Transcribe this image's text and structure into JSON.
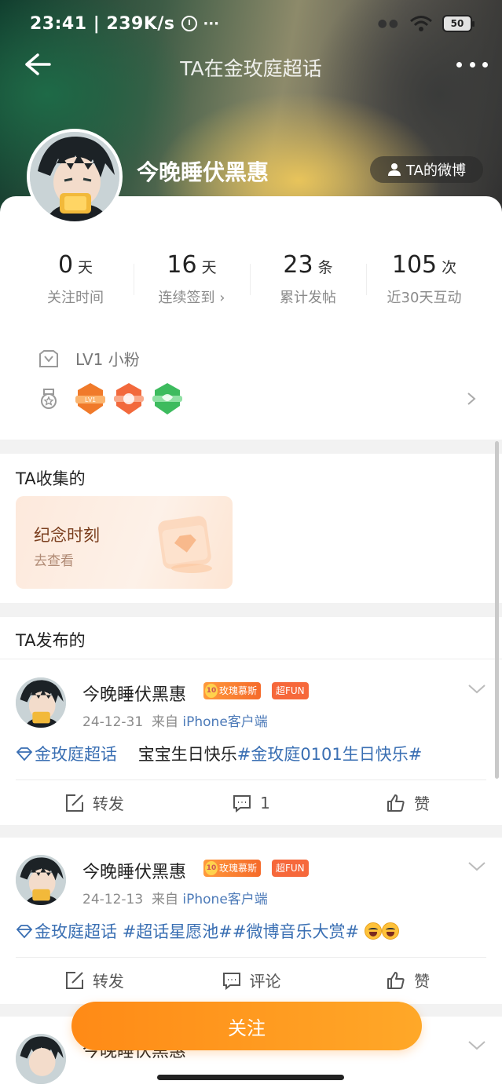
{
  "status_bar": {
    "time": "23:41",
    "net_speed": "239K/s",
    "more": "···",
    "battery": "50"
  },
  "nav": {
    "title": "TA在金玫庭超话"
  },
  "profile": {
    "username": "今晚睡伏黑惠",
    "weibo_link": "TA的微博",
    "stats": [
      {
        "value": "0",
        "unit": "天",
        "label": "关注时间"
      },
      {
        "value": "16",
        "unit": "天",
        "label": "连续签到 ›"
      },
      {
        "value": "23",
        "unit": "条",
        "label": "累计发帖"
      },
      {
        "value": "105",
        "unit": "次",
        "label": "近30天互动"
      }
    ],
    "level": "LV1 小粉",
    "badges": [
      {
        "name": "lv-badge",
        "color": "#f07a2a",
        "text": "LV1"
      },
      {
        "name": "rose-badge",
        "color": "#f2693c",
        "text": ""
      },
      {
        "name": "green-badge",
        "color": "#3dbb5e",
        "text": ""
      }
    ]
  },
  "collected": {
    "title": "TA收集的",
    "card_title": "纪念时刻",
    "card_sub": "去查看"
  },
  "published": {
    "title": "TA发布的",
    "posts": [
      {
        "author": "今晚睡伏黑惠",
        "rose_tag": "玫瑰慕斯",
        "fun_tag": "超FUN",
        "date": "24-12-31",
        "source_prefix": "来自",
        "source": "iPhone客户端",
        "topic": "金玫庭超话",
        "text": "宝宝生日快乐",
        "hashtag": "#金玫庭0101生日快乐#",
        "repost": "转发",
        "comment": "1",
        "like": "赞"
      },
      {
        "author": "今晚睡伏黑惠",
        "rose_tag": "玫瑰慕斯",
        "fun_tag": "超FUN",
        "date": "24-12-13",
        "source_prefix": "来自",
        "source": "iPhone客户端",
        "topic": "金玫庭超话",
        "hashtag": "#超话星愿池##微博音乐大赏#",
        "repost": "转发",
        "comment": "评论",
        "like": "赞"
      },
      {
        "author": "今晚睡伏黑惠"
      }
    ]
  },
  "follow_button": "关注",
  "colors": {
    "accent_orange": "#ff9a1f",
    "link_blue": "#3a6fb3"
  }
}
